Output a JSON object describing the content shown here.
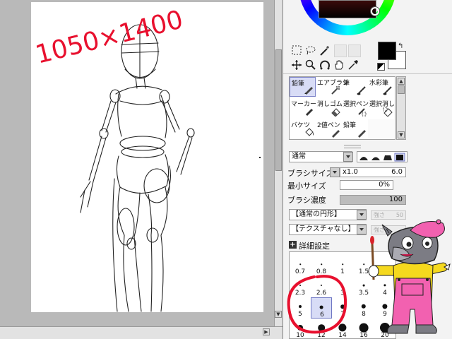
{
  "canvas": {
    "annotation_text": "1050×1400"
  },
  "tools": {
    "rows": [
      [
        "select-rect-tool",
        "lasso-tool",
        "magic-wand-tool",
        "",
        ""
      ],
      [
        "move-tool",
        "zoom-tool",
        "rotate-tool",
        "hand-tool",
        "eyedropper-tool"
      ]
    ]
  },
  "brush_tools": {
    "items": [
      {
        "label": "鉛筆",
        "selected": true
      },
      {
        "label": "エアブラシ",
        "selected": false
      },
      {
        "label": "筆",
        "selected": false
      },
      {
        "label": "水彩筆",
        "selected": false
      },
      {
        "label": "マーカー",
        "selected": false
      },
      {
        "label": "消しゴム",
        "selected": false
      },
      {
        "label": "選択ペン",
        "selected": false
      },
      {
        "label": "選択消し",
        "selected": false
      },
      {
        "label": "バケツ",
        "selected": false
      },
      {
        "label": "2値ペン",
        "selected": false
      },
      {
        "label": "鉛筆",
        "selected": false
      },
      {
        "label": "",
        "selected": false
      }
    ]
  },
  "settings": {
    "blend_mode": "通常",
    "brush_size_label": "ブラシサイズ",
    "brush_size_multiplier": "x1.0",
    "brush_size_value": "6.0",
    "min_size_label": "最小サイズ",
    "min_size_value": "0%",
    "density_label": "ブラシ濃度",
    "density_value": "100",
    "density_fraction": 1.0,
    "shape": "【通常の円形】",
    "shape_strength_label": "強さ",
    "shape_strength_value": "50",
    "texture": "【テクスチャなし】",
    "texture_strength_label": "強さ",
    "advanced_label": "詳細設定"
  },
  "brush_sizes": {
    "rows": [
      [
        "0.7",
        "0.8",
        "1",
        "1.5",
        ""
      ],
      [
        "2.3",
        "2.6",
        "3",
        "3.5",
        "4"
      ],
      [
        "5",
        "6",
        "7",
        "8",
        "9"
      ],
      [
        "10",
        "12",
        "14",
        "16",
        "20"
      ]
    ],
    "selected": "6"
  },
  "colors": {
    "primary": "#000000",
    "secondary": "#ffffff",
    "annotation": "#e8102e",
    "selection": "#d8dcf6"
  }
}
